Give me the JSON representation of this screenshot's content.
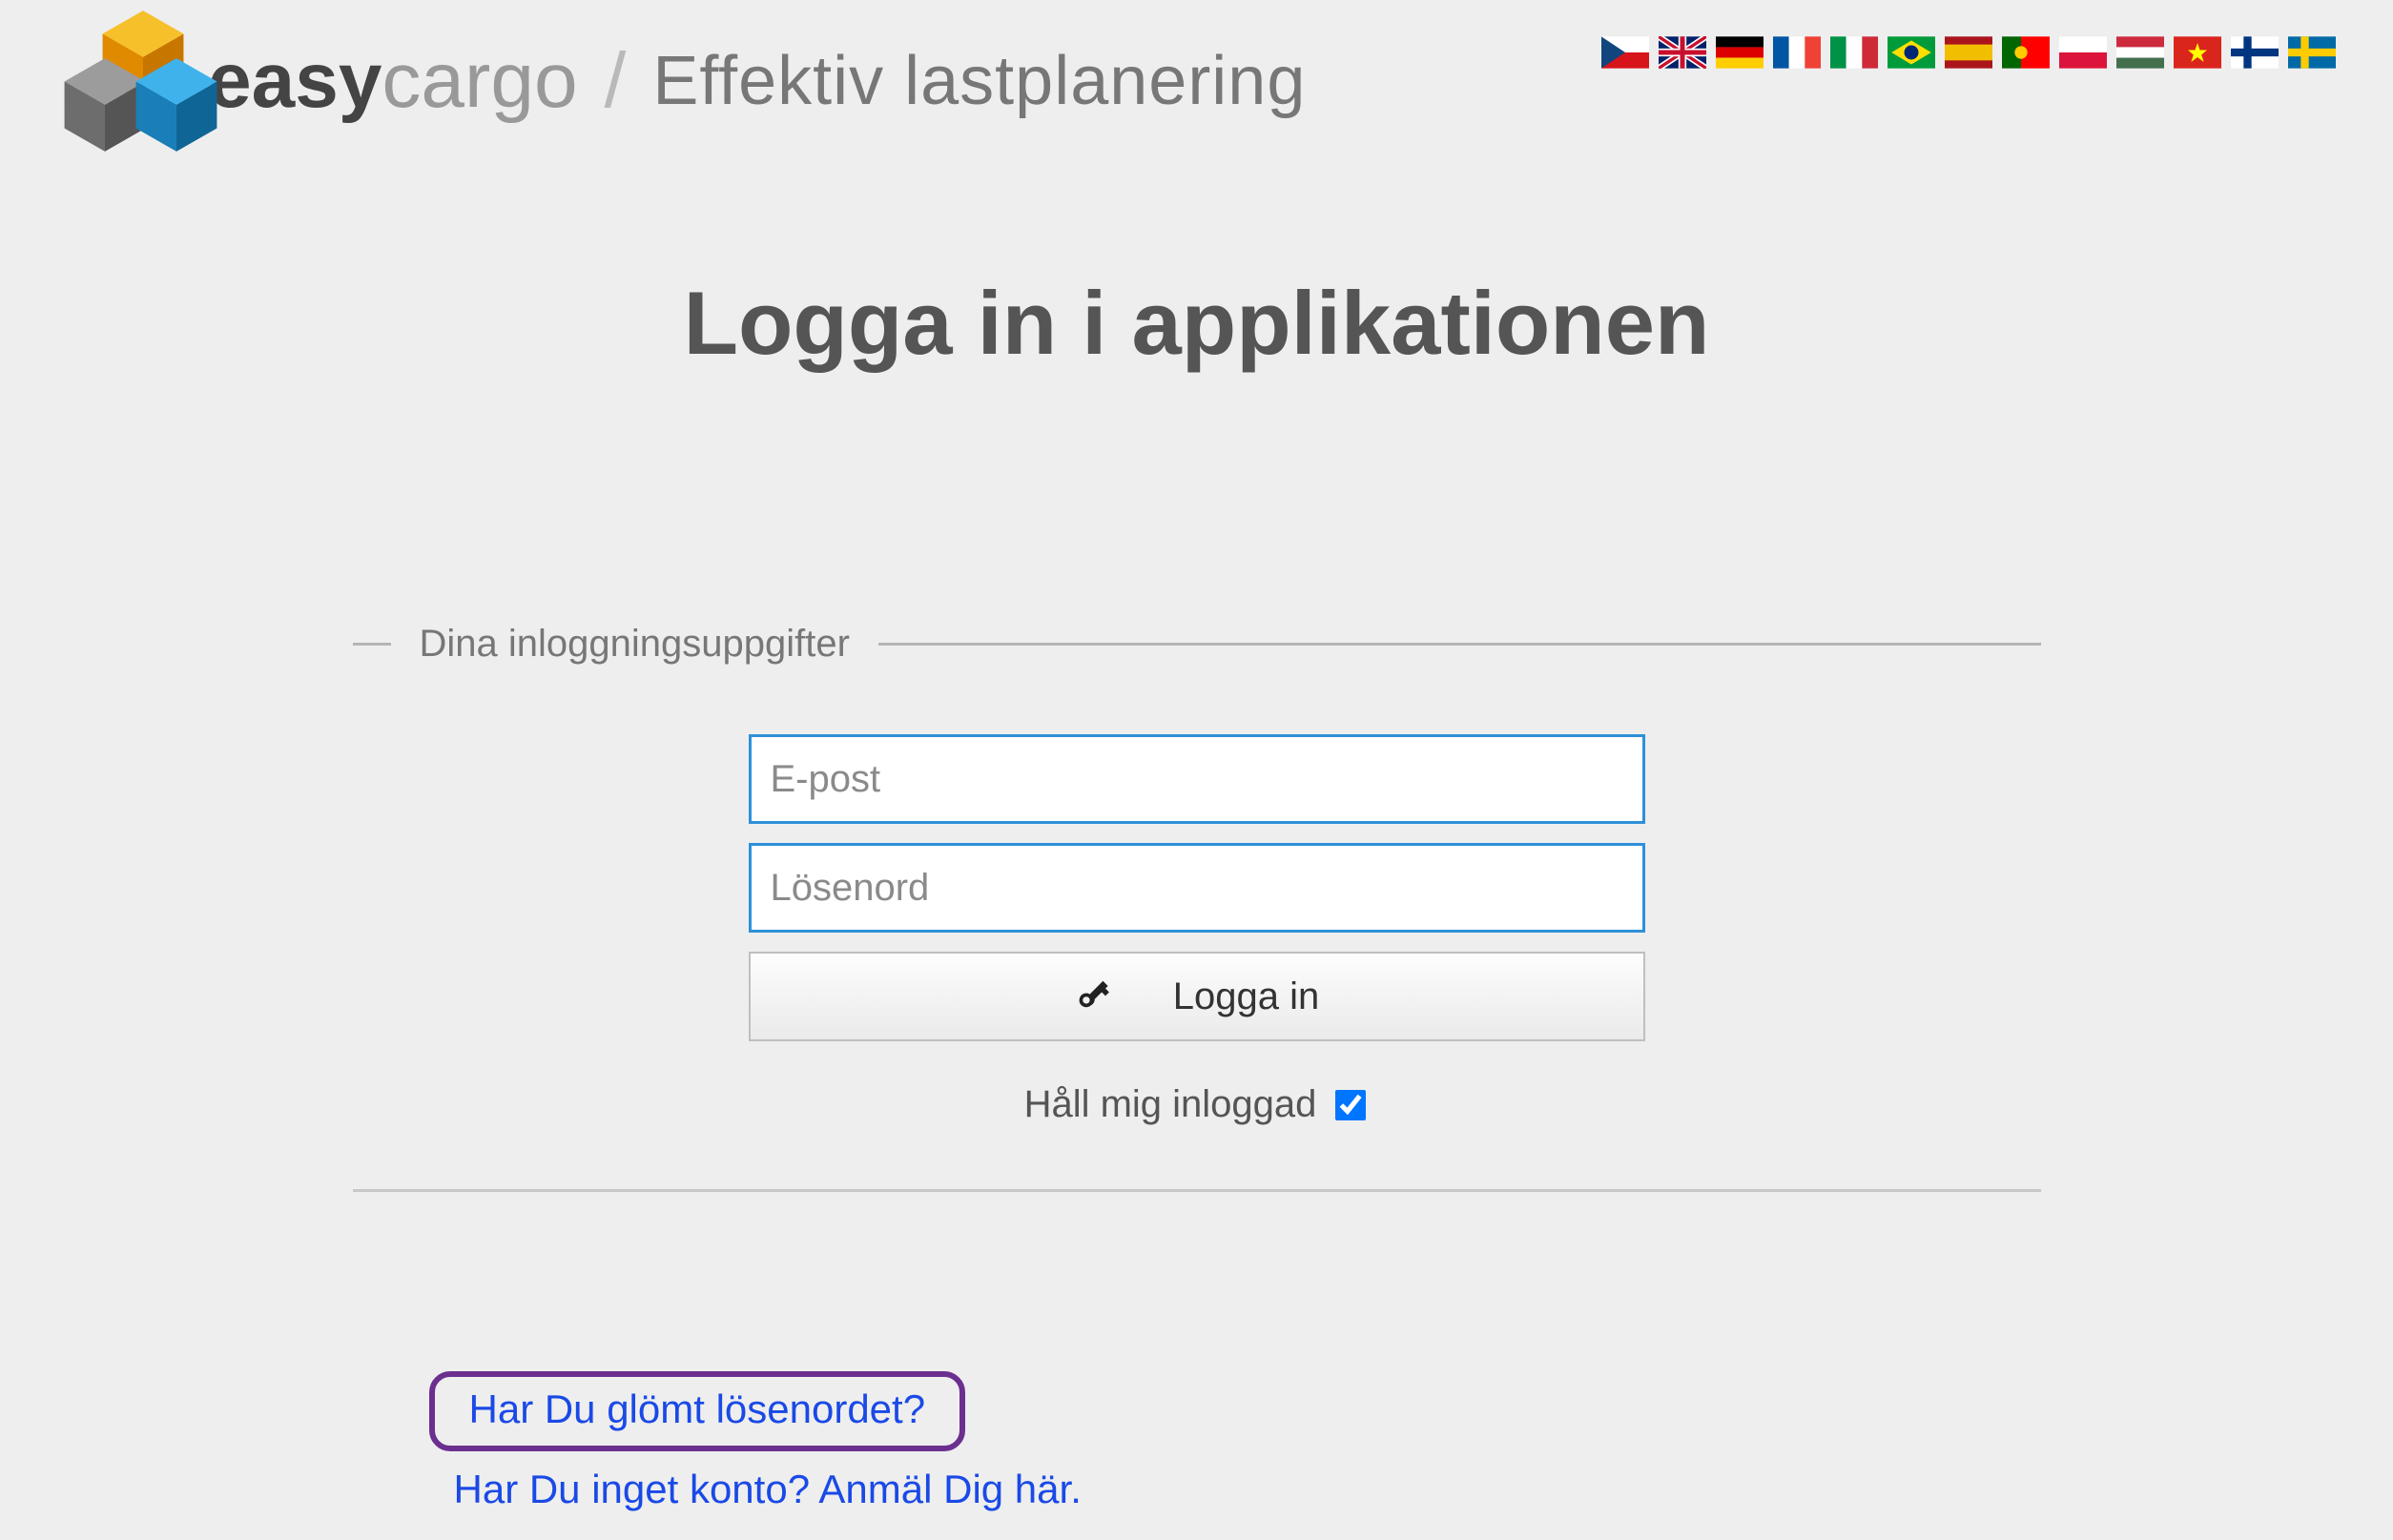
{
  "brand": {
    "name_part1": "easy",
    "name_part2": "cargo",
    "separator": "/",
    "tagline": "Effektiv lastplanering"
  },
  "languages": [
    "cz",
    "gb",
    "de",
    "fr",
    "it",
    "br",
    "es",
    "pt",
    "pl",
    "hu",
    "vn",
    "fi",
    "se"
  ],
  "page": {
    "heading": "Logga in i applikationen"
  },
  "form": {
    "legend": "Dina inloggningsuppgifter",
    "email_placeholder": "E-post",
    "password_placeholder": "Lösenord",
    "submit_label": "Logga in",
    "keep_logged_label": "Håll mig inloggad",
    "keep_logged_checked": true
  },
  "links": {
    "forgot_password": "Har Du glömt lösenordet?",
    "no_account": "Har Du inget konto? Anmäl Dig här."
  }
}
